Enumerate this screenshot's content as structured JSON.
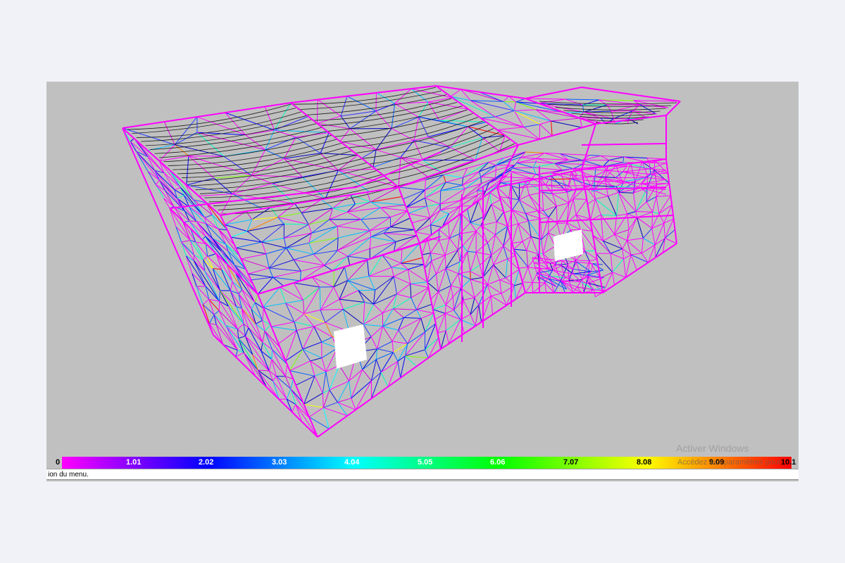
{
  "viewport": {
    "background": "#c0c0c0",
    "model_description_colors": {
      "edge": "#ff00ff",
      "mesh_low": "#0000ff",
      "mesh_high": "#ff0000",
      "cable": "#1a1a1a"
    }
  },
  "colorbar": {
    "gradient_stops": [
      "#ff00ff",
      "#8000ff",
      "#0000ff",
      "#0080ff",
      "#00ffff",
      "#00ff80",
      "#00ff00",
      "#80ff00",
      "#ffff00",
      "#ff8000",
      "#ff0000"
    ],
    "tick_labels": [
      "0",
      "1.01",
      "2.02",
      "3.03",
      "4.04",
      "5.05",
      "6.06",
      "7.07",
      "8.08",
      "9.09",
      "10.1"
    ],
    "tick_label_partial_last": "1"
  },
  "statusbar": {
    "text": "ion du menu."
  },
  "watermark": {
    "title": "Activer Windows",
    "subtitle": "Accédez aux paramètres pour"
  }
}
